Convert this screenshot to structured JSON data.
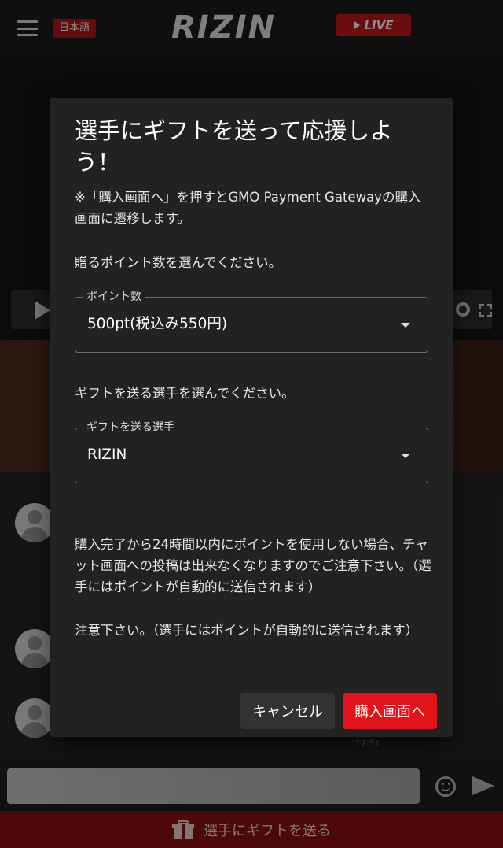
{
  "header": {
    "language_label": "日本語",
    "logo_text": "RIZIN",
    "live_label": "LIVE"
  },
  "chat": {
    "timestamp": "12:51"
  },
  "gift_bar": {
    "label": "選手にギフトを送る"
  },
  "dialog": {
    "title": "選手にギフトを送って応援しよう！",
    "note": "※「購入画面へ」を押すとGMO Payment Gatewayの購入画面に遷移します。",
    "points_prompt": "贈るポイント数を選んでください。",
    "points_field": {
      "label": "ポイント数",
      "value": "500pt(税込み550円)"
    },
    "player_prompt": "ギフトを送る選手を選んでください。",
    "player_field": {
      "label": "ギフトを送る選手",
      "value": "RIZIN"
    },
    "notice": "購入完了から24時間以内にポイントを使用しない場合、チャット画面への投稿は出来なくなりますのでご注意下さい。（選手にはポイントが自動的に送信されます）",
    "notice_repeat": "注意下さい。（選手にはポイントが自動的に送信されます）",
    "cancel_label": "キャンセル",
    "purchase_label": "購入画面へ"
  },
  "colors": {
    "brand_red": "#e3131c",
    "dialog_bg": "#222222"
  }
}
